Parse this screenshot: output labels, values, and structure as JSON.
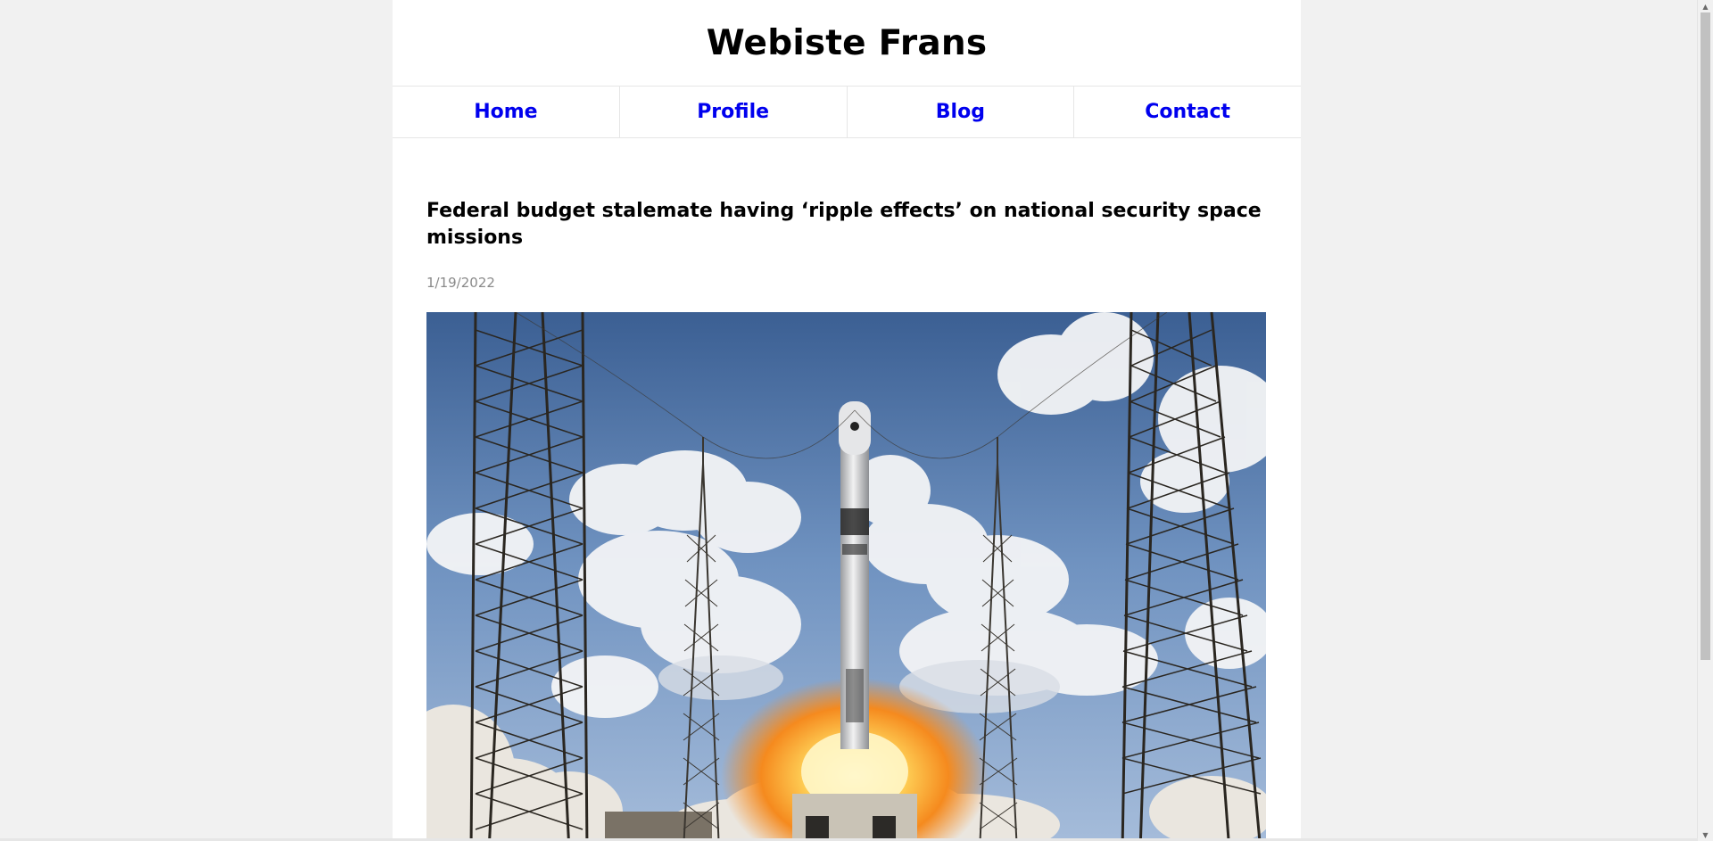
{
  "site": {
    "title": "Webiste Frans"
  },
  "nav": {
    "items": [
      {
        "label": "Home"
      },
      {
        "label": "Profile"
      },
      {
        "label": "Blog"
      },
      {
        "label": "Contact"
      }
    ],
    "link_color": "#0000ee"
  },
  "article": {
    "title": "Federal budget stalemate having ‘ripple effects’ on national security space missions",
    "date": "1/19/2022",
    "image_subject": "rocket-launch-photo"
  },
  "scrollbar": {
    "up_icon": "triangle-up-icon",
    "down_icon": "triangle-down-icon"
  }
}
